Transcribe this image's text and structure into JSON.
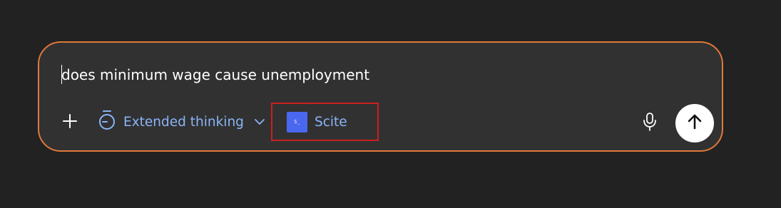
{
  "composer": {
    "input_value": "does minimum wage cause unemployment",
    "accent_color": "#e0793a",
    "background_color": "#313131"
  },
  "toolbar": {
    "add_icon": "plus-icon",
    "thinking": {
      "icon": "stopwatch-icon",
      "label": "Extended thinking",
      "chevron_icon": "chevron-down-icon"
    },
    "integration": {
      "logo_text": "S_",
      "label": "Scite",
      "logo_color": "#4a67f0",
      "highlight_color": "#cc1f1f"
    },
    "mic_icon": "microphone-icon",
    "send_icon": "arrow-up-icon"
  }
}
